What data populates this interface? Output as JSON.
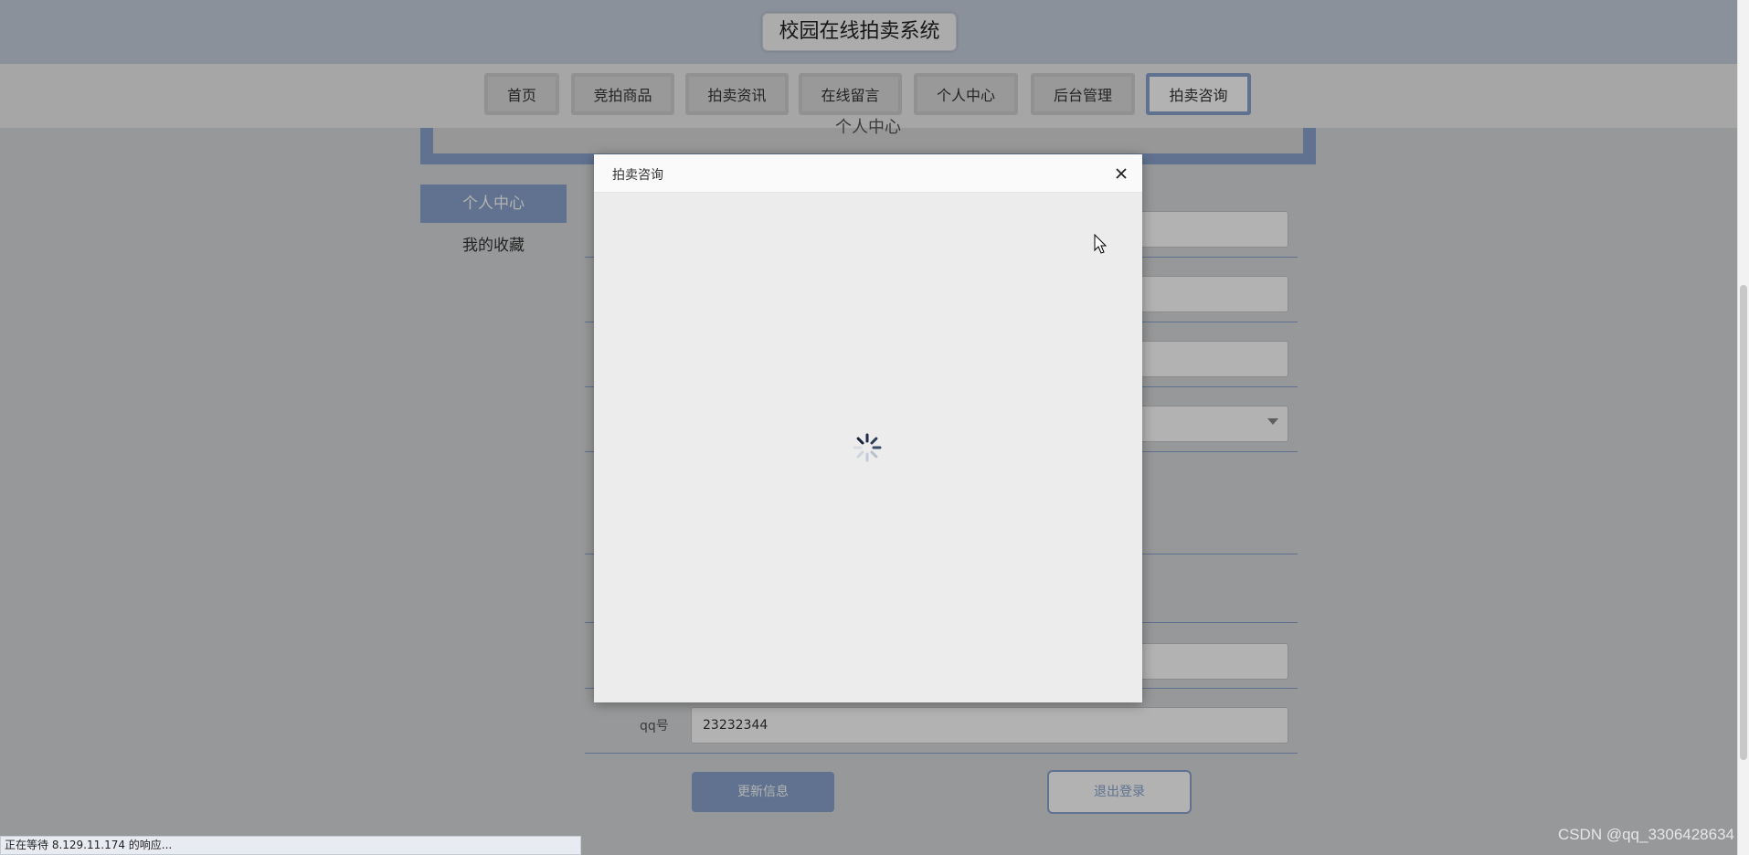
{
  "site": {
    "title": "校园在线拍卖系统"
  },
  "nav": {
    "items": [
      {
        "label": "首页"
      },
      {
        "label": "竞拍商品"
      },
      {
        "label": "拍卖资讯"
      },
      {
        "label": "在线留言"
      },
      {
        "label": "个人中心"
      },
      {
        "label": "后台管理"
      },
      {
        "label": "拍卖咨询",
        "active": true
      }
    ]
  },
  "banner": {
    "text": "个人中心"
  },
  "sidebar": {
    "items": [
      {
        "label": "个人中心",
        "active": true
      },
      {
        "label": "我的收藏"
      }
    ]
  },
  "form": {
    "qq_label": "qq号",
    "qq_value": "23232344",
    "update_button": "更新信息",
    "logout_button": "退出登录"
  },
  "modal": {
    "title": "拍卖咨询",
    "close_icon": "close-icon",
    "loading_icon": "spinner-icon"
  },
  "status_bar": {
    "text": "正在等待 8.129.11.174 的响应..."
  },
  "watermark": {
    "text": "CSDN @qq_3306428634"
  },
  "colors": {
    "accent": "#8aa4cf",
    "overlay": "rgba(0,0,0,0.30)"
  }
}
